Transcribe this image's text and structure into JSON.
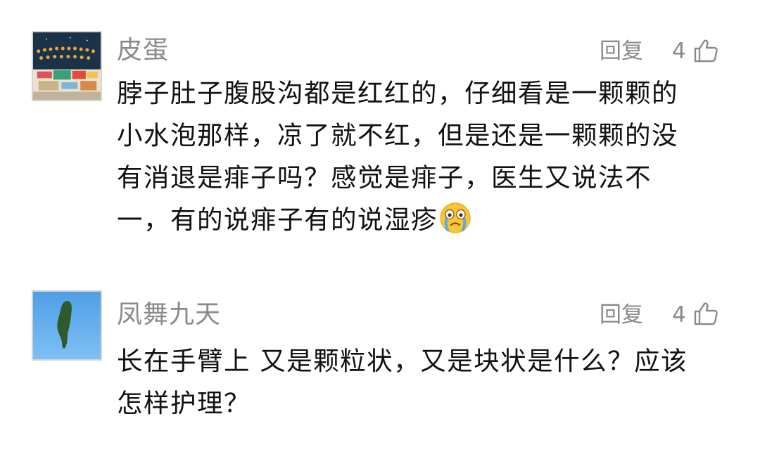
{
  "comments": [
    {
      "username": "皮蛋",
      "reply_label": "回复",
      "like_count": "4",
      "text": "脖子肚子腹股沟都是红红的，仔细看是一颗颗的小水泡那样，凉了就不红，但是还是一颗颗的没有消退是痱子吗？感觉是痱子，医生又说法不一，有的说痱子有的说湿疹",
      "emoji": "crying-face-emoji",
      "avatar": "market-night-scene-avatar"
    },
    {
      "username": "凤舞九天",
      "reply_label": "回复",
      "like_count": "4",
      "text": "长在手臂上 又是颗粒状，又是块状是什么？应该怎样护理？",
      "avatar": "taiwan-island-map-avatar"
    }
  ],
  "icons": {
    "like": "thumbs-up-icon"
  },
  "colors": {
    "meta_gray": "#8a8a8a",
    "text": "#111111",
    "avatar_sky_blue": "#5aa9ea",
    "avatar_island_green": "#2f5a2a"
  }
}
